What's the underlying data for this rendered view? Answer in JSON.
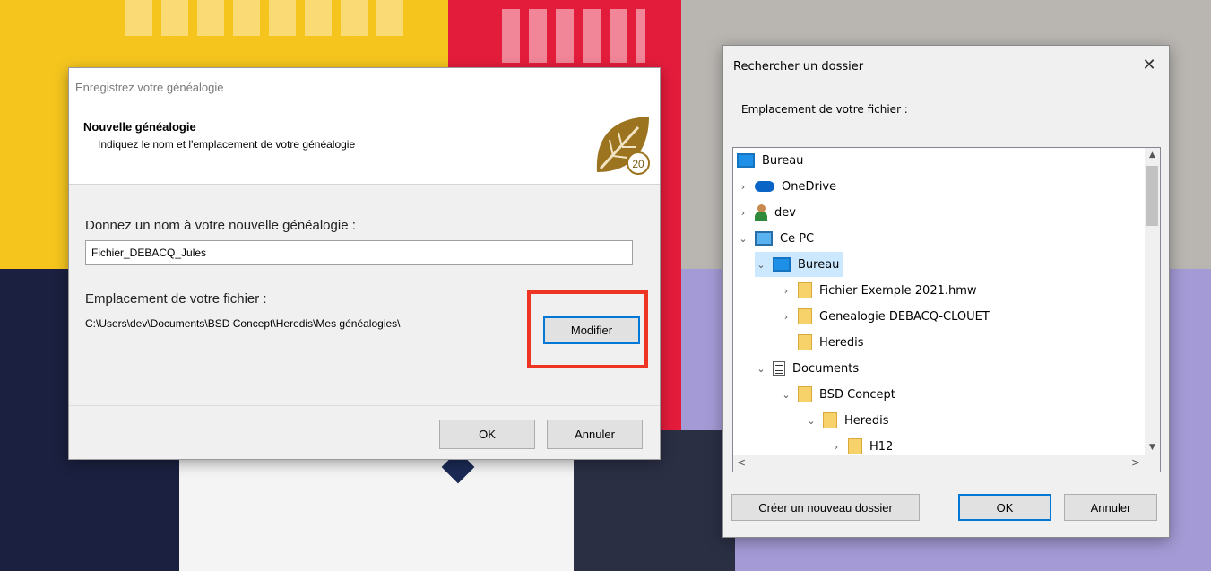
{
  "colors": {
    "accent": "#0078d7",
    "highlight_box": "#ee3523",
    "selection": "#cce8ff"
  },
  "dialog_save": {
    "window_title": "Enregistrez votre généalogie",
    "header_title": "Nouvelle généalogie",
    "header_subtitle": "Indiquez le nom et l'emplacement de votre généalogie",
    "logo_text": "20",
    "name_label": "Donnez un nom à votre nouvelle généalogie :",
    "name_value": "Fichier_DEBACQ_Jules",
    "location_label": "Emplacement de votre fichier :",
    "location_path": "C:\\Users\\dev\\Documents\\BSD Concept\\Heredis\\Mes généalogies\\",
    "modify_button": "Modifier",
    "ok_button": "OK",
    "cancel_button": "Annuler"
  },
  "dialog_browse": {
    "window_title": "Rechercher un dossier",
    "close_glyph": "✕",
    "prompt": "Emplacement de votre fichier :",
    "tree": [
      {
        "label": "Bureau",
        "icon": "desktop-icon",
        "expander": "none",
        "level": 0
      },
      {
        "label": "OneDrive",
        "icon": "cloud-icon",
        "expander": "collapsed",
        "level": 0
      },
      {
        "label": "dev",
        "icon": "user-icon",
        "expander": "collapsed",
        "level": 0
      },
      {
        "label": "Ce PC",
        "icon": "computer-icon",
        "expander": "expanded",
        "level": 0
      },
      {
        "label": "Bureau",
        "icon": "desktop-icon",
        "expander": "expanded",
        "level": 1,
        "selected": true
      },
      {
        "label": "Fichier Exemple 2021.hmw",
        "icon": "folder-icon",
        "expander": "collapsed",
        "level": 2
      },
      {
        "label": "Genealogie DEBACQ-CLOUET",
        "icon": "folder-icon",
        "expander": "collapsed",
        "level": 2
      },
      {
        "label": "Heredis",
        "icon": "folder-icon",
        "expander": "none",
        "level": 2
      },
      {
        "label": "Documents",
        "icon": "documents-icon",
        "expander": "expanded",
        "level": 1
      },
      {
        "label": "BSD Concept",
        "icon": "folder-icon",
        "expander": "expanded",
        "level": 2
      },
      {
        "label": "Heredis",
        "icon": "folder-icon",
        "expander": "expanded",
        "level": 3
      },
      {
        "label": "H12",
        "icon": "folder-icon",
        "expander": "collapsed",
        "level": 4
      }
    ],
    "new_folder_button": "Créer un nouveau dossier",
    "ok_button": "OK",
    "cancel_button": "Annuler"
  }
}
